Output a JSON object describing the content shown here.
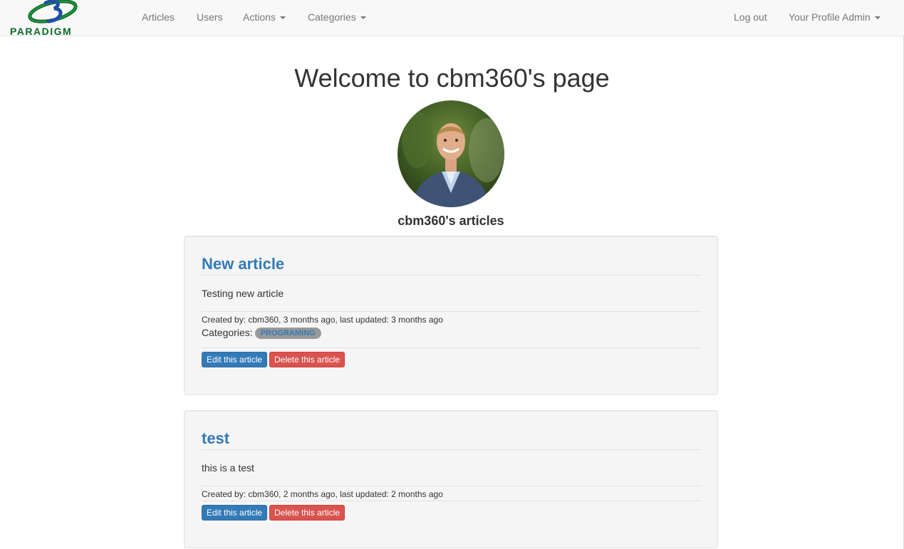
{
  "navbar": {
    "brand": "PARADIGM",
    "links": {
      "articles": "Articles",
      "users": "Users",
      "actions": "Actions",
      "categories": "Categories",
      "logout": "Log out",
      "profile": "Your Profile Admin"
    }
  },
  "page": {
    "title": "Welcome to cbm360's page",
    "articles_heading": "cbm360's articles"
  },
  "articles": [
    {
      "title": "New article",
      "body": "Testing new article",
      "meta": "Created by: cbm360, 3 months ago, last updated: 3 months ago",
      "categories_label": "Categories:",
      "category": "PROGRAMING",
      "edit_label": "Edit this article",
      "delete_label": "Delete this article"
    },
    {
      "title": "test",
      "body": "this is a test",
      "meta": "Created by: cbm360, 2 months ago, last updated: 2 months ago",
      "edit_label": "Edit this article",
      "delete_label": "Delete this article"
    }
  ],
  "colors": {
    "link": "#337ab7",
    "danger": "#d9534f",
    "brand_green": "#0e6a2b",
    "navbar_bg": "#f8f8f8",
    "well_bg": "#f5f5f5"
  }
}
